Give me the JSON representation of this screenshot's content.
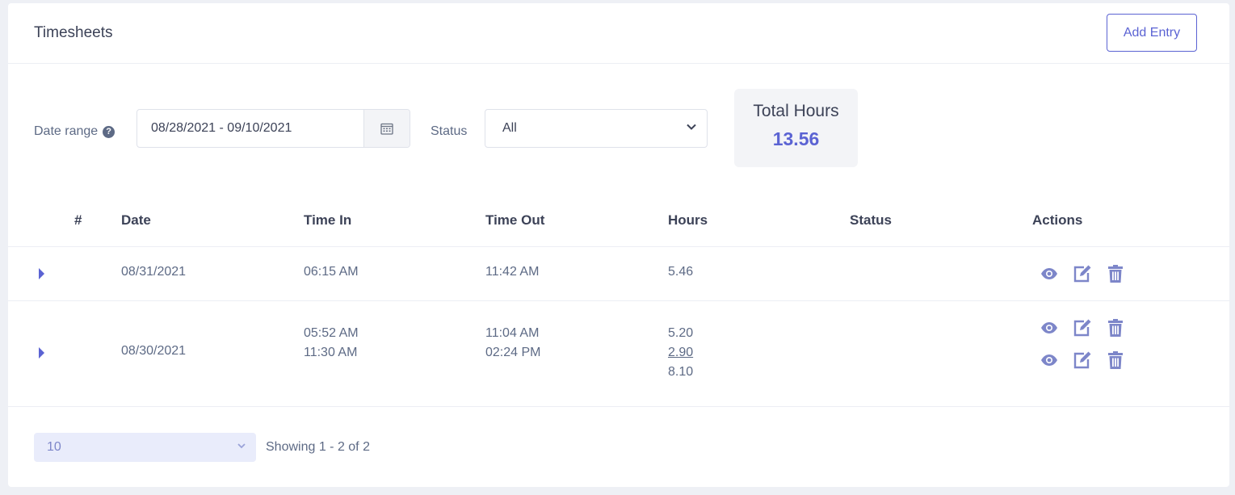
{
  "header": {
    "title": "Timesheets",
    "add_label": "Add Entry"
  },
  "filters": {
    "date_range_label": "Date range",
    "date_range_value": "08/28/2021 - 09/10/2021",
    "status_label": "Status",
    "status_value": "All"
  },
  "total": {
    "label": "Total Hours",
    "value": "13.56"
  },
  "table": {
    "headers": {
      "num": "#",
      "date": "Date",
      "time_in": "Time In",
      "time_out": "Time Out",
      "hours": "Hours",
      "status": "Status",
      "actions": "Actions"
    },
    "rows": [
      {
        "date": "08/31/2021",
        "time_in": [
          "06:15 AM"
        ],
        "time_out": [
          "11:42 AM"
        ],
        "hours": [
          "5.46"
        ],
        "status": ""
      },
      {
        "date": "08/30/2021",
        "time_in": [
          "05:52 AM",
          "11:30 AM"
        ],
        "time_out": [
          "11:04 AM",
          "02:24 PM"
        ],
        "hours": [
          "5.20",
          "2.90",
          "8.10"
        ],
        "status": ""
      }
    ]
  },
  "footer": {
    "page_size": "10",
    "showing": "Showing 1 - 2 of 2"
  },
  "colors": {
    "accent": "#5b63d3",
    "icon": "#7d86c9"
  },
  "icons": [
    "help-icon",
    "calendar-icon",
    "chevron-down-icon",
    "expand-icon",
    "eye-icon",
    "edit-icon",
    "trash-icon"
  ]
}
